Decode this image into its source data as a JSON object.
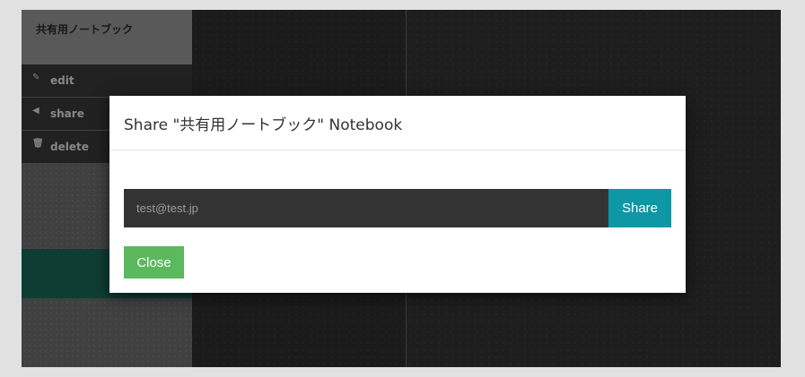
{
  "sidebar": {
    "notebook_title": "共有用ノートブック",
    "menu": [
      {
        "label": "edit",
        "icon": "pencil-icon",
        "glyph": "✎"
      },
      {
        "label": "share",
        "icon": "share-icon",
        "glyph": "◀"
      },
      {
        "label": "delete",
        "icon": "trash-icon",
        "glyph": "🗑"
      }
    ]
  },
  "modal": {
    "title": "Share \"共有用ノートブック\" Notebook",
    "email_value": "test@test.jp",
    "share_label": "Share",
    "close_label": "Close"
  },
  "colors": {
    "share_button": "#0e97a5",
    "close_button": "#5cb85c",
    "teal_bar": "#196a58"
  }
}
